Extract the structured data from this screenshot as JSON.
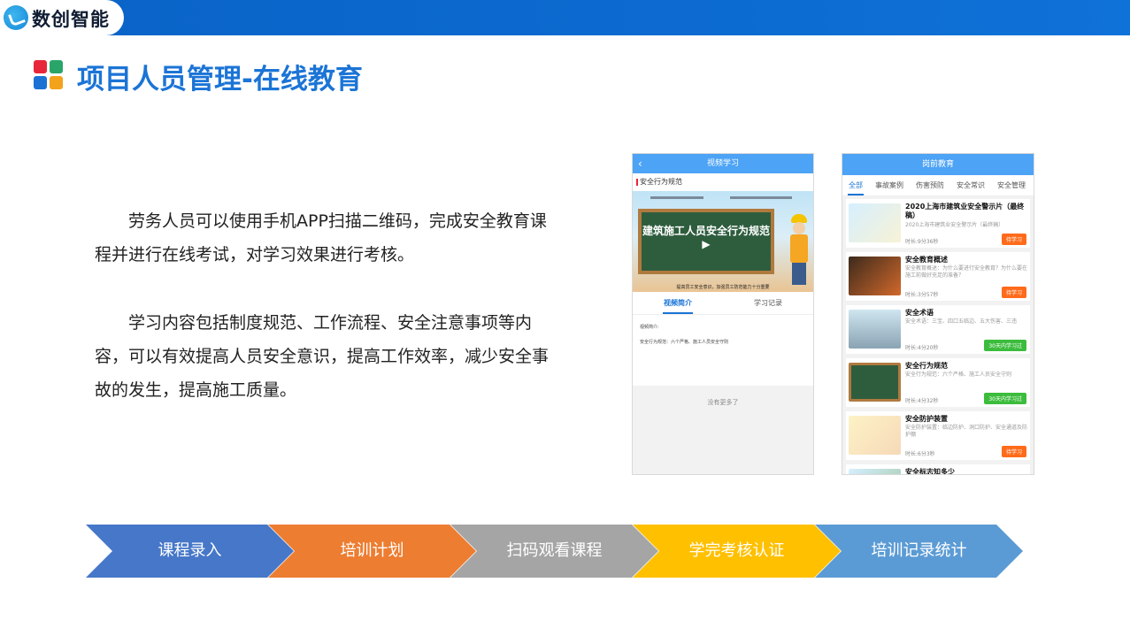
{
  "brand": {
    "name": "数创智能",
    "logo_icon": "brand-logo-icon"
  },
  "title": "项目人员管理-在线教育",
  "paragraphs": [
    "劳务人员可以使用手机APP扫描二维码，完成安全教育课程并进行在线考试，对学习效果进行考核。",
    "学习内容包括制度规范、工作流程、安全注意事项等内容，可以有效提高人员安全意识，提高工作效率，减少安全事故的发生，提高施工质量。"
  ],
  "phone1": {
    "header": "视频学习",
    "back_icon": "chevron-left-icon",
    "subtitle": "安全行为规范",
    "video_title": "建筑施工人员安全行为规范 ▶",
    "video_caption": "提高员工安全意识，加强员工防范能力十分重要",
    "tabs": [
      "视频简介",
      "学习记录"
    ],
    "intro_label": "视频简介:",
    "intro_text": "安全行为规范：六个严格、施工人员安全守则",
    "more": "没有更多了"
  },
  "phone2": {
    "header": "岗前教育",
    "tabs": [
      "全部",
      "事故案例",
      "伤害预防",
      "安全常识",
      "安全管理"
    ],
    "items": [
      {
        "title": "2020上海市建筑业安全警示片（最终稿）",
        "desc": "2020上海市建筑业安全警示片（最终稿）",
        "time": "时长:9分36秒",
        "badge": "待学习",
        "badge_color": "#ff6b1a"
      },
      {
        "title": "安全教育概述",
        "desc": "安全教育概述：为什么要进行安全教育？为什么要在施工前做好充足的准备？",
        "time": "时长:3分57秒",
        "badge": "待学习",
        "badge_color": "#ff6b1a"
      },
      {
        "title": "安全术语",
        "desc": "安全术语：三宝、四口五临边、五大伤害、三违",
        "time": "时长:4分20秒",
        "badge": "30天内学习过",
        "badge_color": "#3cbc3c"
      },
      {
        "title": "安全行为规范",
        "desc": "安全行为规范：六个严格、施工人员安全守则",
        "time": "时长:4分32秒",
        "badge": "30天内学习过",
        "badge_color": "#3cbc3c"
      },
      {
        "title": "安全防护装置",
        "desc": "安全防护装置：临边防护、洞口防护、安全通道及防护棚",
        "time": "时长:6分3秒",
        "badge": "待学习",
        "badge_color": "#ff6b1a"
      },
      {
        "title": "安全标志知多少",
        "desc": "",
        "time": "",
        "badge": "",
        "badge_color": ""
      }
    ]
  },
  "process": [
    {
      "label": "课程录入",
      "color": "#4677c8"
    },
    {
      "label": "培训计划",
      "color": "#ed7d31"
    },
    {
      "label": "扫码观看课程",
      "color": "#a5a5a5"
    },
    {
      "label": "学完考核认证",
      "color": "#ffc000"
    },
    {
      "label": "培训记录统计",
      "color": "#5b9bd5"
    }
  ]
}
